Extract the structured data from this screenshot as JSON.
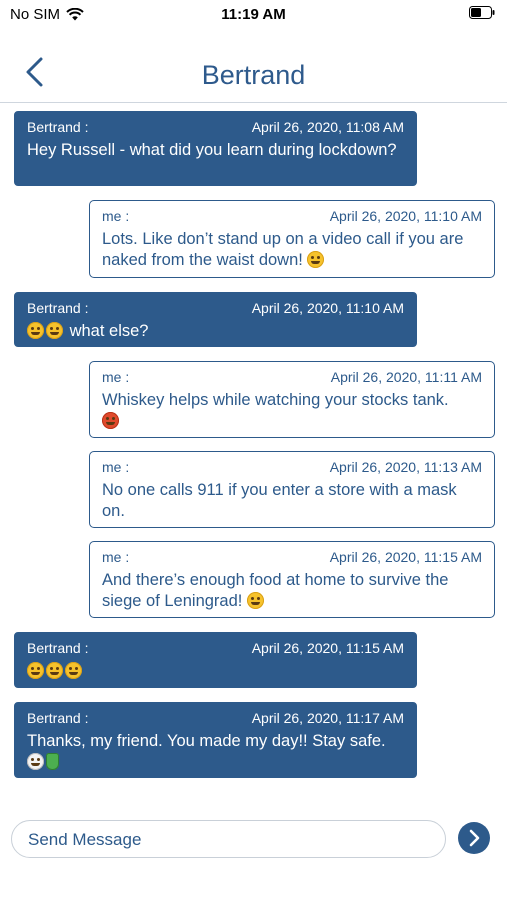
{
  "status_bar": {
    "carrier": "No SIM",
    "time": "11:19 AM"
  },
  "header": {
    "title": "Bertrand",
    "back_icon": "chevron-left-icon"
  },
  "messages": [
    {
      "sender": "Bertrand :",
      "time": "April 26, 2020, 11:08 AM",
      "text": "Hey Russell - what did you learn during lockdown?",
      "emojis": []
    },
    {
      "sender": "me :",
      "time": "April 26, 2020, 11:10 AM",
      "text": "Lots. Like don’t stand up on a video call if you are naked from the waist down!",
      "emojis": [
        "winking-face-emoji"
      ]
    },
    {
      "sender": "Bertrand :",
      "time": "April 26, 2020, 11:10 AM",
      "text": "what else?",
      "emojis": [
        "grinning-face-emoji",
        "grinning-face-emoji"
      ]
    },
    {
      "sender": "me :",
      "time": "April 26, 2020, 11:11 AM",
      "text": "Whiskey helps while watching your stocks tank.",
      "emojis": [
        "angry-face-emoji"
      ]
    },
    {
      "sender": "me :",
      "time": "April 26, 2020, 11:13 AM",
      "text": "No one calls 911 if you enter a store with a mask on.",
      "emojis": []
    },
    {
      "sender": "me :",
      "time": "April 26, 2020, 11:15 AM",
      "text": "And there’s enough food at home to survive the siege of Leningrad!",
      "emojis": [
        "laughing-face-emoji"
      ]
    },
    {
      "sender": "Bertrand :",
      "time": "April 26, 2020, 11:15 AM",
      "text": "",
      "emojis": [
        "rolling-laughing-emoji",
        "rolling-laughing-emoji",
        "rolling-laughing-emoji"
      ]
    },
    {
      "sender": "Bertrand :",
      "time": "April 26, 2020, 11:17 AM",
      "text": "Thanks, my friend. You made my day!!  Stay safe.",
      "emojis": [
        "mask-face-emoji",
        "waving-hand-emoji"
      ]
    }
  ],
  "composer": {
    "placeholder": "Send Message",
    "value": ""
  },
  "colors": {
    "accent": "#2d5a8b",
    "incoming_bg": "#2d5a8b",
    "outgoing_bg": "#ffffff"
  }
}
